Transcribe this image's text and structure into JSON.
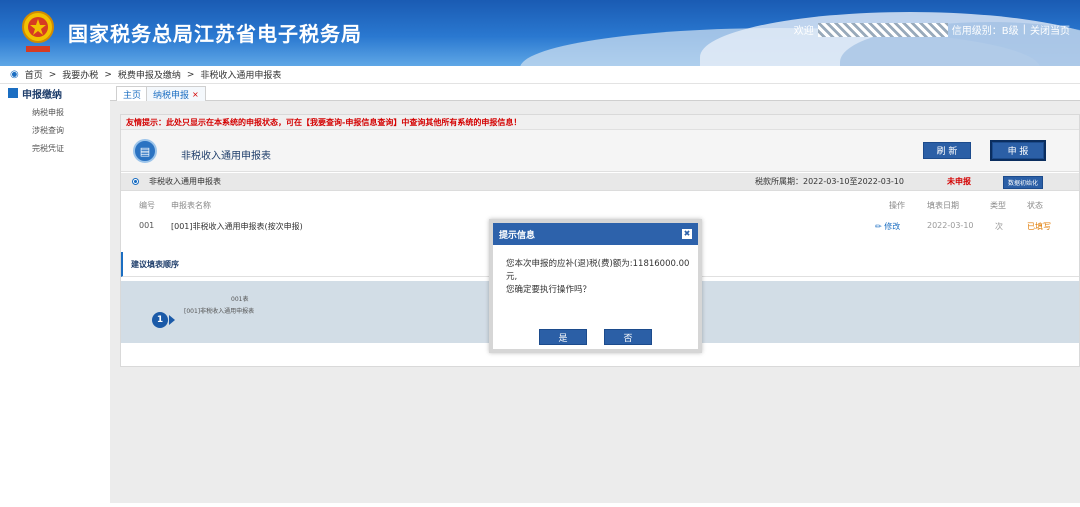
{
  "header": {
    "title": "国家税务总局江苏省电子税务局",
    "welcome": "欢迎",
    "credit_level": "信用级别：B级",
    "separator": "|",
    "close_page": "关闭当页"
  },
  "breadcrumb": {
    "items": [
      "首页",
      "我要办税",
      "税费申报及缴纳",
      "非税收入通用申报表"
    ],
    "sep": ">"
  },
  "sidebar": {
    "header": "申报缴纳",
    "items": [
      "纳税申报",
      "涉税查询",
      "完税凭证"
    ]
  },
  "tabs": {
    "home": "主页",
    "declare": "纳税申报",
    "close_glyph": "×"
  },
  "tip": "友情提示：此处只显示在本系统的申报状态，可在【我要查询-申报信息查询】中查询其他所有系统的申报信息！",
  "form": {
    "title": "非税收入通用申报表",
    "refresh_btn": "刷 新",
    "submit_btn": "申 报",
    "selection_label": "非税收入通用申报表",
    "tax_period": "税款所属期：2022-03-10至2022-03-10",
    "status": "未申报",
    "init_btn": "数据初始化"
  },
  "table": {
    "headers": {
      "no": "编号",
      "name": "申报表名称",
      "op": "操作",
      "date": "填表日期",
      "type": "类型",
      "state": "状态"
    },
    "rows": [
      {
        "no": "001",
        "name": "[001]非税收入通用申报表(按次申报)",
        "op": "修改",
        "date": "2022-03-10",
        "type": "次",
        "state": "已填写"
      }
    ]
  },
  "suggest": {
    "title": "建议填表顺序",
    "step_num": "1",
    "step_code": "001表",
    "step_name": "[001]非税收入通用申报表"
  },
  "dialog": {
    "title": "提示信息",
    "message_line1": "您本次申报的应补(退)税(费)额为:11816000.00",
    "message_line2": "元,",
    "message_line3": "您确定要执行操作吗？",
    "yes": "是",
    "no": "否"
  },
  "colors": {
    "header_blue": "#2a78d0",
    "button_blue": "#2b5fa6",
    "alert_red": "#d40000"
  }
}
